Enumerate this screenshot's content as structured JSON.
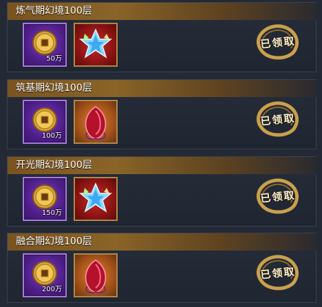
{
  "rewards": [
    {
      "title": "炼气期幻境100层",
      "coin_qty": "50万",
      "gem": "crystal-star-icon",
      "gem_bg": "red",
      "claim_label": "已领取"
    },
    {
      "title": "筑基期幻境100层",
      "coin_qty": "100万",
      "gem": "ruby-gem-icon",
      "gem_bg": "orange",
      "claim_label": "已领取"
    },
    {
      "title": "开光期幻境100层",
      "coin_qty": "150万",
      "gem": "crystal-star-icon",
      "gem_bg": "red",
      "claim_label": "已领取"
    },
    {
      "title": "融合期幻境100层",
      "coin_qty": "200万",
      "gem": "ruby-gem-icon",
      "gem_bg": "orange",
      "claim_label": "已领取"
    }
  ],
  "colors": {
    "coin_slot": "#5a2696",
    "gold": "#c9a04c",
    "header": "#7a5320"
  }
}
